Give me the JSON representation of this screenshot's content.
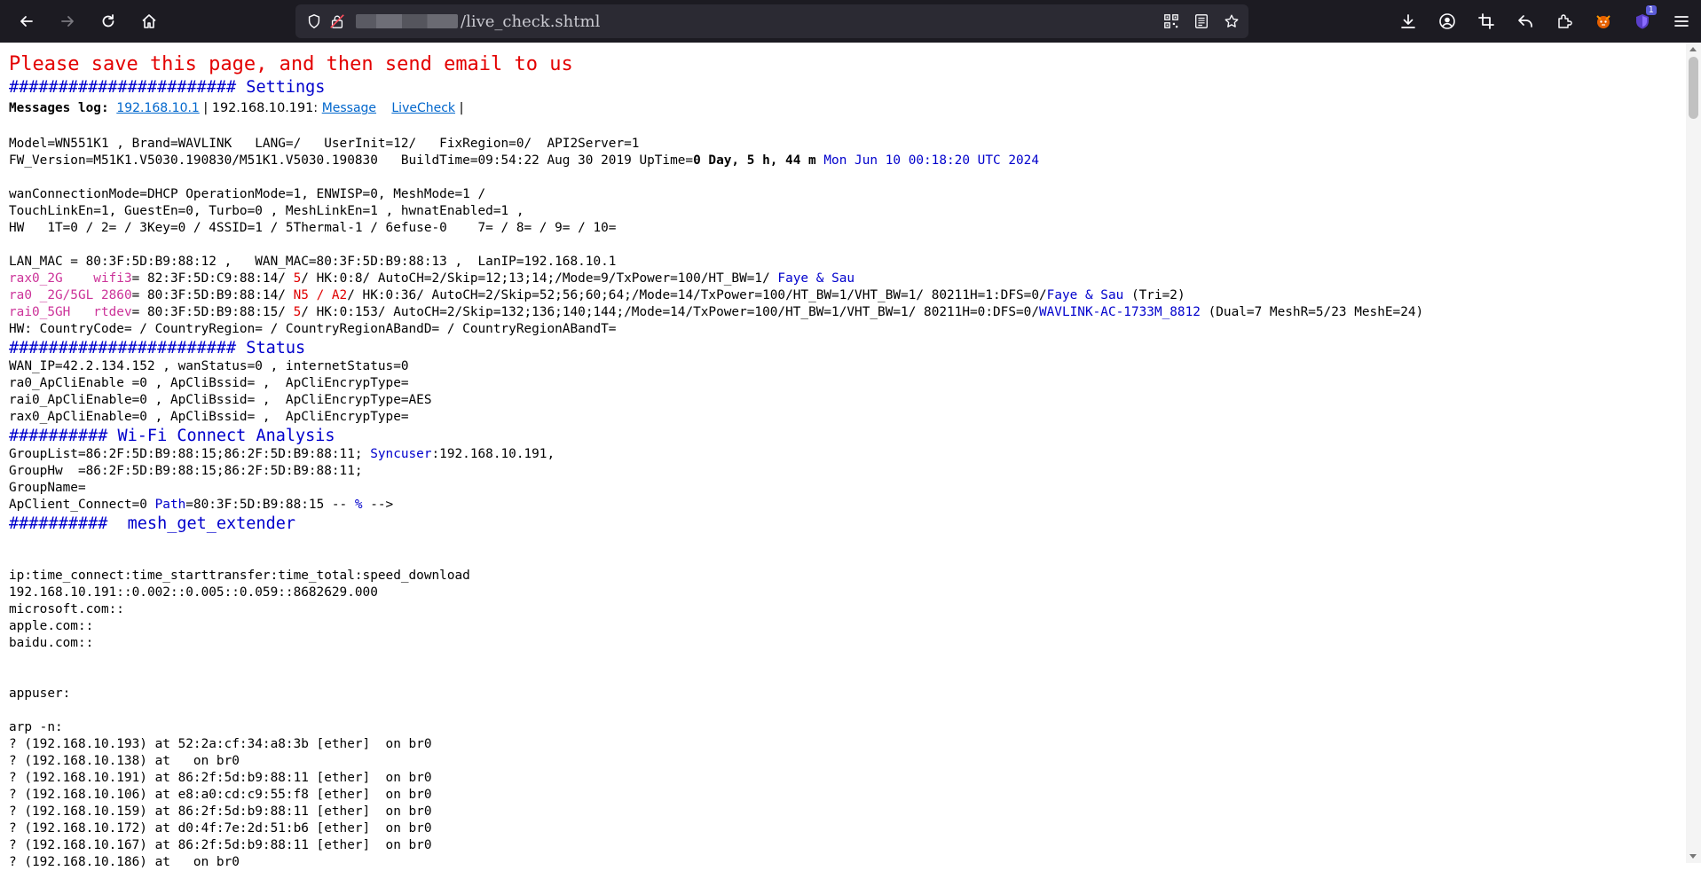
{
  "browser": {
    "url_suffix": "/live_check.shtml",
    "extension_badge": "1",
    "colors": {
      "toolbar": "#1c1b22",
      "urlbar": "#2b2a33",
      "accent_red": "#e30000",
      "accent_blue": "#0000cc"
    }
  },
  "page": {
    "notice": "Please save this page, and then send email to us",
    "settings_heading": "####################### Settings",
    "messages_log_label": "Messages log:",
    "messages_log_link": "192.168.10.1",
    "sep1": " | 192.168.10.191: ",
    "message_link": "Message",
    "livecheck_link": "LiveCheck",
    "sep2": " |",
    "line_model": "Model=WN551K1 , Brand=WAVLINK   LANG=/   UserInit=12/   FixRegion=0/  API2Server=1",
    "fw_a": "FW_Version=M51K1.V5030.190830/M51K1.V5030.190830   BuildTime=09:54:22 Aug 30 2019 UpTime=",
    "fw_uptime": "0 Day, 5 h, 44 m",
    "fw_date": "Mon Jun 10 00:18:20 UTC 2024",
    "wan_mode": "wanConnectionMode=DHCP OperationMode=1, ENWISP=0, MeshMode=1 /",
    "touch_link": "TouchLinkEn=1, GuestEn=0, Turbo=0 , MeshLinkEn=1 , hwnatEnabled=1 ,",
    "hw_line": "HW   1T=0 / 2= / 3Key=0 / 4SSID=1 / 5Thermal-1 / 6efuse-0    7= / 8= / 9= / 10=",
    "lan_mac": "LAN_MAC = 80:3F:5D:B9:88:12 ,   WAN_MAC=80:3F:5D:B9:88:13 ,  LanIP=192.168.10.1",
    "rax0_label": "rax0_2G    wifi3",
    "rax0_a": "= 82:3F:5D:C9:88:14/ ",
    "rax0_ch": "5",
    "rax0_b": "/ HK:0:8/ AutoCH=2/Skip=12;13;14;/Mode=9/TxPower=100/HT_BW=1/ ",
    "rax0_ssid": "Faye & Sau",
    "ra0_label": "ra0 _2G/5GL 2860",
    "ra0_a": "= 80:3F:5D:B9:88:14/ ",
    "ra0_ch": "N5 / A2",
    "ra0_b": "/ HK:0:36/ AutoCH=2/Skip=52;56;60;64;/Mode=14/TxPower=100/HT_BW=1/VHT_BW=1/ 80211H=1:DFS=0/",
    "ra0_ssid": "Faye & Sau",
    "ra0_tail": " (Tri=2)",
    "rai0_label": "rai0_5GH   rtdev",
    "rai0_a": "= 80:3F:5D:B9:88:15/ ",
    "rai0_ch": "5",
    "rai0_b": "/ HK:0:153/ AutoCH=2/Skip=132;136;140;144;/Mode=14/TxPower=100/HT_BW=1/VHT_BW=1/ 80211H=0:DFS=0/",
    "rai0_ssid": "WAVLINK-AC-1733M_8812",
    "rai0_tail": " (Dual=7 MeshR=5/23 MeshE=24)",
    "hw_country": "HW: CountryCode= / CountryRegion= / CountryRegionABandD= / CountryRegionABandT=",
    "status_heading": "####################### Status",
    "wan_ip": "WAN_IP=42.2.134.152 , wanStatus=0 , internetStatus=0",
    "apcli1": "ra0_ApCliEnable =0 , ApCliBssid= ,  ApCliEncrypType=",
    "apcli2": "rai0_ApCliEnable=0 , ApCliBssid= ,  ApCliEncrypType=AES",
    "apcli3": "rax0_ApCliEnable=0 , ApCliBssid= ,  ApCliEncrypType=",
    "wifi_heading": "########## Wi-Fi Connect Analysis",
    "group_list_a": "GroupList=86:2F:5D:B9:88:15;86:2F:5D:B9:88:11; ",
    "syncuser_label": "Syncuser",
    "group_list_b": ":192.168.10.191,",
    "group_hw": "GroupHw  =86:2F:5D:B9:88:15;86:2F:5D:B9:88:11;",
    "group_name": "GroupName=",
    "apclient_a": "ApClient_Connect=0 ",
    "path_label": "Path",
    "apclient_b": "=80:3F:5D:B9:88:15 -- ",
    "apclient_pct": "%",
    "apclient_c": " -->",
    "mesh_heading": "##########  mesh_get_extender",
    "speed_header": "ip:time_connect:time_starttransfer:time_total:speed_download",
    "speed_rows": [
      "192.168.10.191::0.002::0.005::0.059::8682629.000",
      "microsoft.com::",
      "apple.com::",
      "baidu.com::"
    ],
    "appuser": "appuser:",
    "arp_cmd": "arp -n:",
    "arp_rows": [
      "? (192.168.10.193) at 52:2a:cf:34:a8:3b [ether]  on br0",
      "? (192.168.10.138) at   on br0",
      "? (192.168.10.191) at 86:2f:5d:b9:88:11 [ether]  on br0",
      "? (192.168.10.106) at e8:a0:cd:c9:55:f8 [ether]  on br0",
      "? (192.168.10.159) at 86:2f:5d:b9:88:11 [ether]  on br0",
      "? (192.168.10.172) at d0:4f:7e:2d:51:b6 [ether]  on br0",
      "? (192.168.10.167) at 86:2f:5d:b9:88:11 [ether]  on br0",
      "? (192.168.10.186) at   on br0"
    ]
  }
}
